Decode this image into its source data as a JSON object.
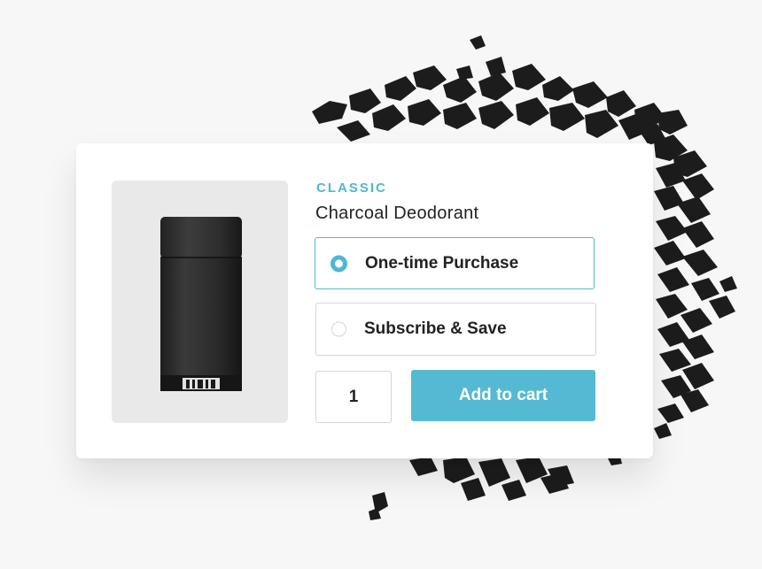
{
  "product": {
    "category": "CLASSIC",
    "title": "Charcoal Deodorant",
    "image_icon": "deodorant-stick-icon"
  },
  "purchase_options": [
    {
      "label": "One-time Purchase",
      "selected": true
    },
    {
      "label": "Subscribe & Save",
      "selected": false
    }
  ],
  "quantity": {
    "value": "1"
  },
  "add_to_cart": {
    "label": "Add to cart"
  },
  "colors": {
    "accent": "#55b9d3",
    "background": "#f7f7f7",
    "charcoal": "#1b1b1b",
    "image_bg": "#e9e9e9"
  }
}
